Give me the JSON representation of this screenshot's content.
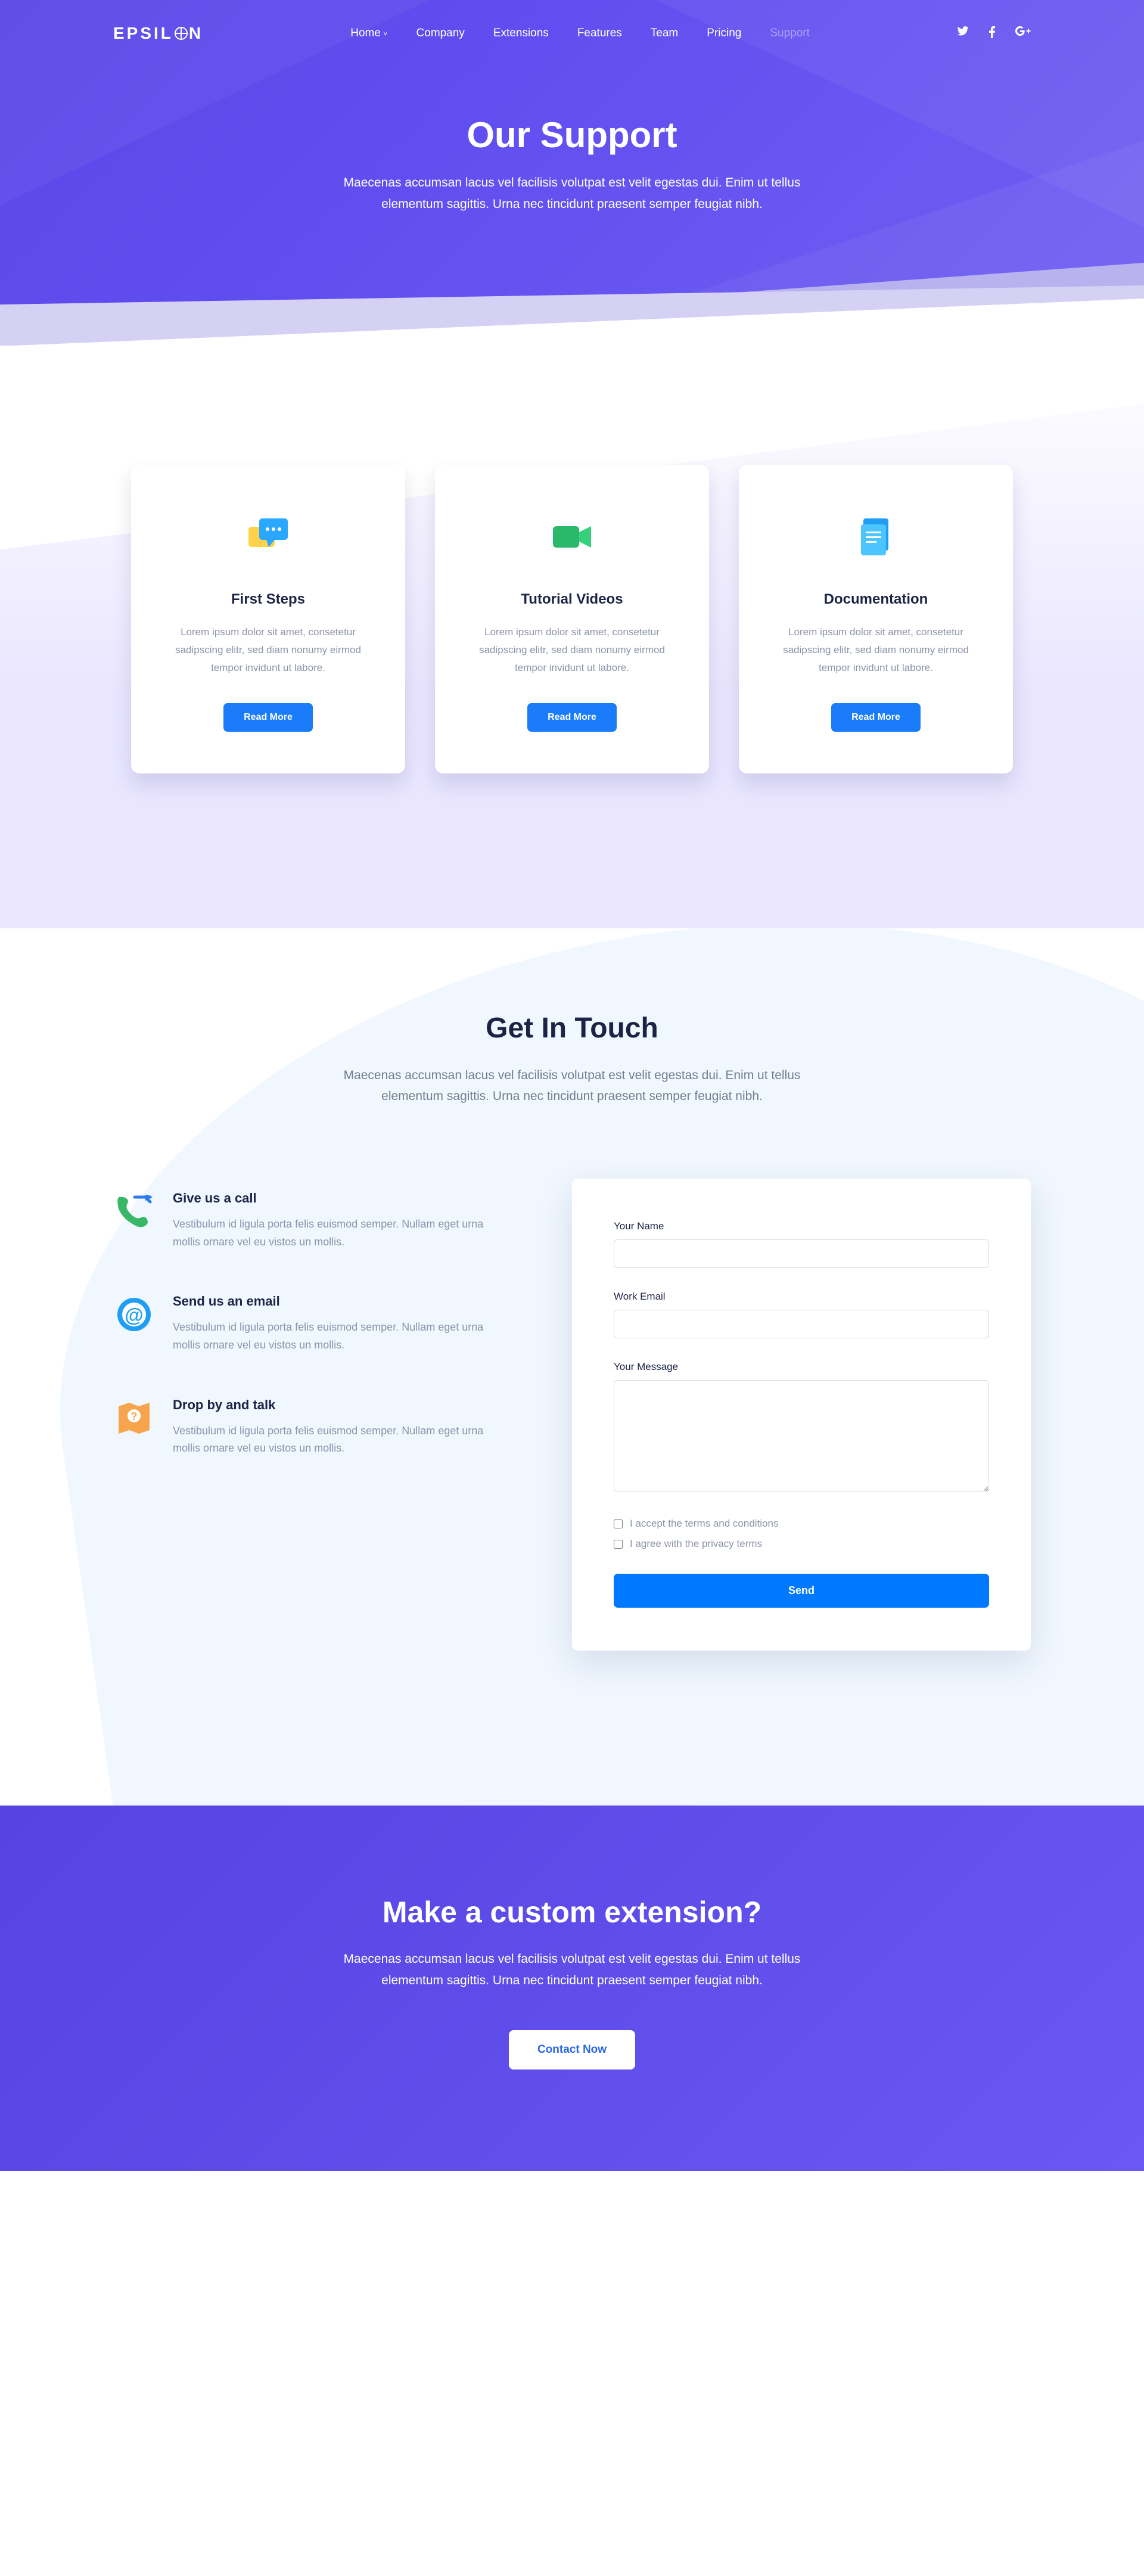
{
  "nav": {
    "logo_a": "EPSIL",
    "logo_b": "N",
    "items": [
      "Home",
      "Company",
      "Extensions",
      "Features",
      "Team",
      "Pricing",
      "Support"
    ],
    "active_index": 6
  },
  "hero": {
    "title": "Our Support",
    "subtitle": "Maecenas accumsan lacus vel facilisis volutpat est velit egestas dui. Enim ut tellus elementum sagittis. Urna nec tincidunt praesent semper feugiat nibh."
  },
  "cards": [
    {
      "title": "First Steps",
      "desc": "Lorem ipsum dolor sit amet, consetetur sadipscing elitr, sed diam nonumy eirmod tempor invidunt ut labore.",
      "cta": "Read More"
    },
    {
      "title": "Tutorial Videos",
      "desc": "Lorem ipsum dolor sit amet, consetetur sadipscing elitr, sed diam nonumy eirmod tempor invidunt ut labore.",
      "cta": "Read More"
    },
    {
      "title": "Documentation",
      "desc": "Lorem ipsum dolor sit amet, consetetur sadipscing elitr, sed diam nonumy eirmod tempor invidunt ut labore.",
      "cta": "Read More"
    }
  ],
  "contact": {
    "title": "Get In Touch",
    "subtitle": "Maecenas accumsan lacus vel facilisis volutpat est velit egestas dui. Enim ut tellus elementum sagittis. Urna nec tincidunt praesent semper feugiat nibh.",
    "info": [
      {
        "title": "Give us a call",
        "desc": "Vestibulum id ligula porta felis euismod semper. Nullam eget urna mollis ornare vel eu vistos un mollis."
      },
      {
        "title": "Send us an email",
        "desc": "Vestibulum id ligula porta felis euismod semper. Nullam eget urna mollis ornare vel eu vistos un mollis."
      },
      {
        "title": "Drop by and talk",
        "desc": "Vestibulum id ligula porta felis euismod semper. Nullam eget urna mollis ornare vel eu vistos un mollis."
      }
    ],
    "form": {
      "label_name": "Your Name",
      "label_email": "Work Email",
      "label_message": "Your Message",
      "check_terms": "I accept the terms and conditions",
      "check_privacy": "I agree with the privacy terms",
      "submit": "Send"
    }
  },
  "cta": {
    "title": "Make a custom extension?",
    "subtitle": "Maecenas accumsan lacus vel facilisis volutpat est velit egestas dui. Enim ut tellus elementum sagittis. Urna nec tincidunt praesent semper feugiat nibh.",
    "button": "Contact Now"
  }
}
